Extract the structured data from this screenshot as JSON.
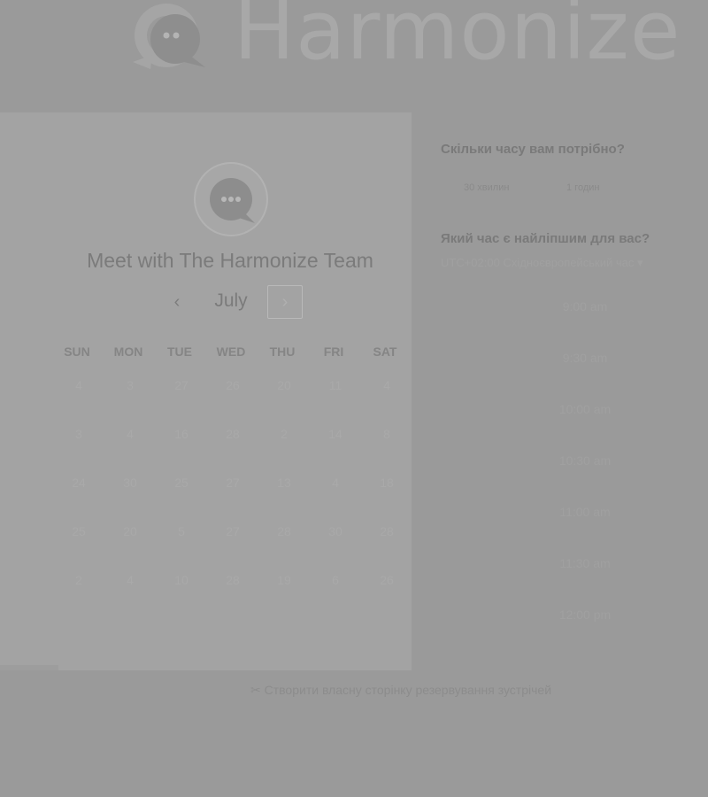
{
  "header": {
    "brand": "Harmonize"
  },
  "card": {
    "title": "Meet with The Harmonize Team",
    "month": "July",
    "weekdays": [
      "SUN",
      "MON",
      "TUE",
      "WED",
      "THU",
      "FRI",
      "SAT"
    ],
    "weeks": [
      [
        "4",
        "3",
        "27",
        "26",
        "20",
        "11",
        "4"
      ],
      [
        "3",
        "4",
        "16",
        "28",
        "2",
        "14",
        "8"
      ],
      [
        "24",
        "30",
        "25",
        "27",
        "13",
        "4",
        "18"
      ],
      [
        "25",
        "20",
        "5",
        "27",
        "28",
        "30",
        "28"
      ],
      [
        "2",
        "4",
        "10",
        "28",
        "19",
        "6",
        "26"
      ]
    ]
  },
  "booking": {
    "duration_question": "Скільки часу вам потрібно?",
    "durations": [
      "30 хвилин",
      "1 годин"
    ],
    "time_question": "Який час є найліпшим для вас?",
    "timezone": "UTC+02:00 Східноєвропейський час",
    "slots": [
      "9:00 am",
      "9:30 am",
      "10:00 am",
      "10:30 am",
      "11:00 am",
      "11:30 am",
      "12:00 pm"
    ]
  },
  "footer": {
    "create_link": "Створити власну сторінку резервування зустрічей"
  },
  "colors": {
    "overlay": "#9a9a9a",
    "card": "#a3a3a3"
  }
}
